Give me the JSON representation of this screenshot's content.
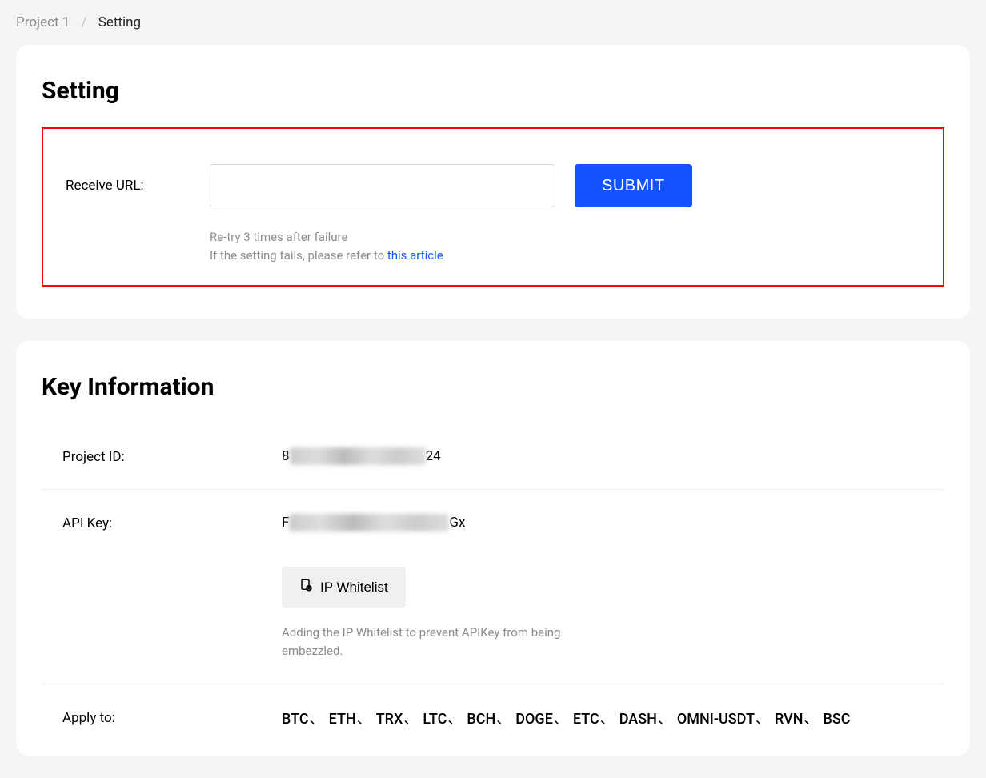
{
  "breadcrumb": {
    "parent": "Project 1",
    "current": "Setting"
  },
  "setting_card": {
    "title": "Setting",
    "receive_url_label": "Receive URL:",
    "receive_url_value": "",
    "submit_label": "SUBMIT",
    "hint_line1": "Re-try 3 times after failure",
    "hint_line2_prefix": "If the setting fails, please refer to ",
    "hint_link": "this article"
  },
  "key_card": {
    "title": "Key Information",
    "project_id_label": "Project ID:",
    "project_id_prefix": "8",
    "project_id_suffix": "24",
    "api_key_label": "API Key:",
    "api_key_prefix": "F",
    "api_key_suffix": "Gx",
    "ip_whitelist_label": "IP Whitelist",
    "whitelist_hint": "Adding the IP Whitelist to prevent APIKey from being embezzled.",
    "apply_to_label": "Apply to:",
    "apply_to_items": [
      "BTC",
      "ETH",
      "TRX",
      "LTC",
      "BCH",
      "DOGE",
      "ETC",
      "DASH",
      "OMNI-USDT",
      "RVN",
      "BSC"
    ]
  }
}
